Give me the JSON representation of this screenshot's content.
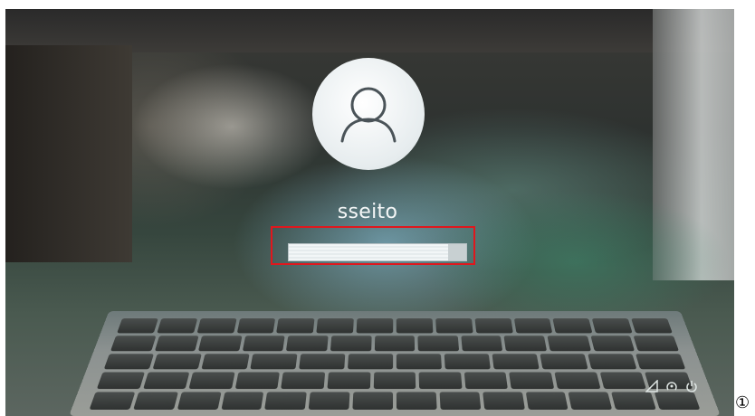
{
  "login": {
    "username": "sseito",
    "password_placeholder": ""
  },
  "annotation": {
    "marker": "①",
    "highlight_color": "#e0171d"
  },
  "icons": {
    "avatar": "user-icon",
    "network": "network-icon",
    "accessibility": "ease-of-access-icon",
    "power": "power-icon"
  },
  "colors": {
    "avatar_bg": "#e6ecee",
    "username_text": "#f5f7f7"
  }
}
